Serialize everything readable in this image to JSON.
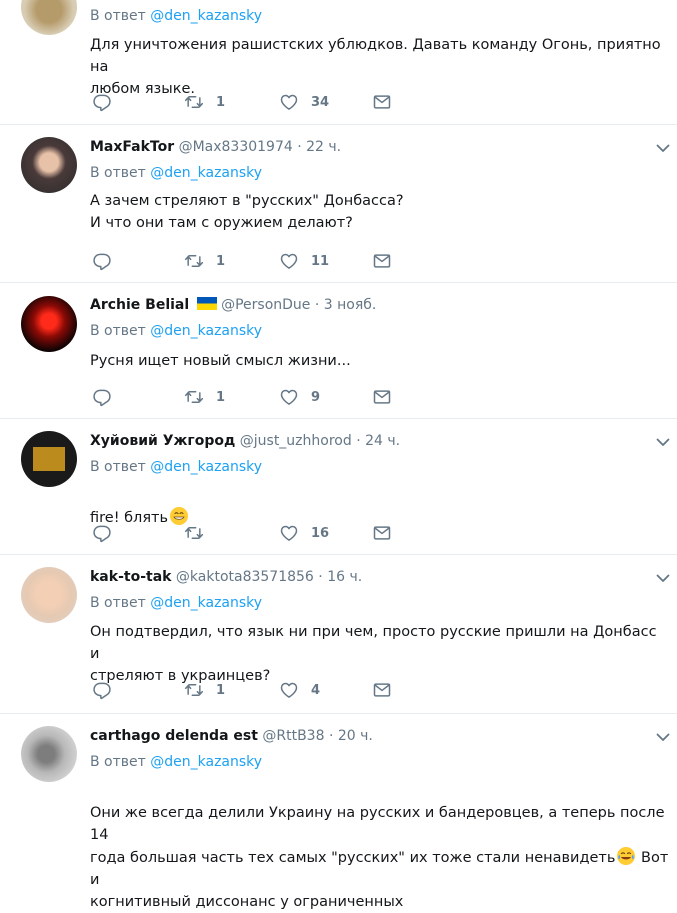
{
  "colors": {
    "accent": "#1da1f2",
    "muted": "#657786",
    "text": "#14171a",
    "divider": "#e6ecf0"
  },
  "common": {
    "reply_prefix": "В ответ",
    "reply_mention": "@den_kazansky",
    "separator": "·"
  },
  "tweets": [
    {
      "name": "",
      "handle": "",
      "time": "",
      "text": "Для уничтожения рашистских ублюдков. Давать команду Огонь, приятно на\nлюбом языке.",
      "replies": "",
      "retweets": "1",
      "likes": "34"
    },
    {
      "name": "MaxFakTor",
      "handle": "@Max83301974",
      "time": "22 ч.",
      "text": "А зачем стреляют в \"русских\" Донбасса?\nИ что они там с оружием делают?",
      "replies": "",
      "retweets": "1",
      "likes": "11"
    },
    {
      "name": "Archie Belial",
      "handle": "@PersonDue",
      "time": "3 нояб.",
      "text": "Русня ищет новый смысл жизни...",
      "replies": "",
      "retweets": "1",
      "likes": "9"
    },
    {
      "name": "Хуйовий Ужгород",
      "handle": "@just_uzhhorod",
      "time": "24 ч.",
      "text": "fire! блять",
      "replies": "",
      "retweets": "",
      "likes": "16"
    },
    {
      "name": "kak-to-tak",
      "handle": "@kaktota83571856",
      "time": "16 ч.",
      "text": "Он подтвердил, что язык ни при чем, просто русские пришли на Донбасс и\nстреляют в украинцев?",
      "replies": "",
      "retweets": "1",
      "likes": "4"
    },
    {
      "name": "carthago delenda est",
      "handle": "@RttB38",
      "time": "20 ч.",
      "text": "Они же всегда делили Украину на русских и бандеровцев, а теперь после 14\nгода большая часть тех самых \"русских\" их тоже стали ненавидеть",
      "text_tail": " Вот и\nкогнитивный диссонанс у ограниченных",
      "replies": "",
      "retweets": "",
      "likes": ""
    }
  ]
}
